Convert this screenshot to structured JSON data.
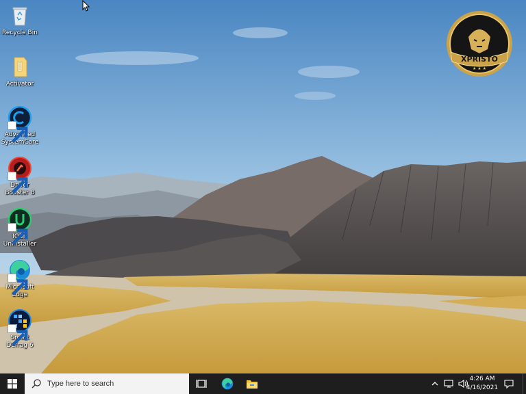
{
  "desktop": {
    "icons": [
      {
        "label": "Recycle Bin",
        "icon": "recycle-bin-icon"
      },
      {
        "label": "Activator",
        "icon": "folder-icon"
      },
      {
        "label": "Advanced SystemCare",
        "icon": "advanced-systemcare-icon"
      },
      {
        "label": "Driver Booster 8",
        "icon": "driver-booster-icon"
      },
      {
        "label": "IObit Uninstaller",
        "icon": "iobit-uninstaller-icon"
      },
      {
        "label": "Microsoft Edge",
        "icon": "edge-icon"
      },
      {
        "label": "Smart Defrag 6",
        "icon": "smart-defrag-icon"
      }
    ],
    "logo_text": "XPRISTO"
  },
  "taskbar": {
    "search_placeholder": "Type here to search",
    "time": "4:26 AM",
    "date": "4/16/2021"
  },
  "colors": {
    "taskbar_bg": "#1e1e1e",
    "accent_blue": "#0078d7",
    "logo_gold": "#c9a24a"
  }
}
